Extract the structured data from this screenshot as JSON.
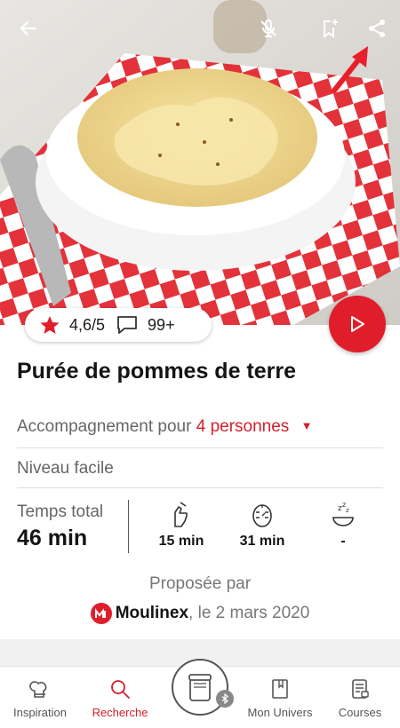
{
  "recipe": {
    "title": "Purée de pommes de terre",
    "rating": "4,6/5",
    "comments": "99+",
    "portions_prefix": "Accompagnement pour",
    "portions_value": "4 personnes",
    "level": "Niveau facile"
  },
  "times": {
    "total_label": "Temps total",
    "total_value": "46 min",
    "prep": "15 min",
    "cook": "31 min",
    "rest": "-"
  },
  "author": {
    "proposed_by": "Proposée par",
    "brand": "Moulinex",
    "date": ", le 2 mars 2020"
  },
  "nav": {
    "items": [
      {
        "label": "Inspiration",
        "icon": "chef-hat-icon"
      },
      {
        "label": "Recherche",
        "icon": "search-icon"
      },
      {
        "label": "Mon Univers",
        "icon": "book-icon"
      },
      {
        "label": "Courses",
        "icon": "shopping-list-icon"
      }
    ]
  },
  "icons": {
    "back": "back-arrow-icon",
    "mic_off": "mic-off-icon",
    "bookmark_add": "bookmark-add-icon",
    "share": "share-icon",
    "play": "play-icon"
  },
  "colors": {
    "accent": "#e01e2b",
    "text": "#141414",
    "muted": "#666666"
  }
}
